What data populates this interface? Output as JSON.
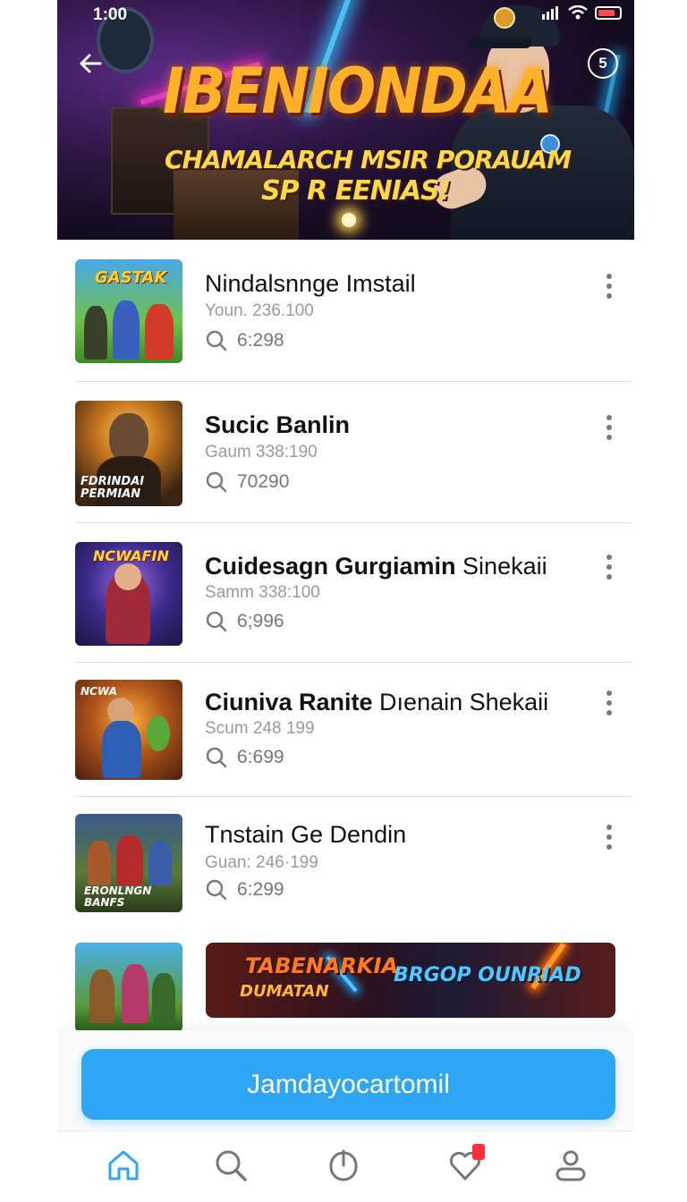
{
  "status_bar": {
    "time": "1:00"
  },
  "hero": {
    "title": "IBENIONDAA",
    "subtitle_line1": "CHAMALARCH MSIR PORAUAM",
    "subtitle_line2": "SP R EENIAS!",
    "timer_label": "5"
  },
  "games": [
    {
      "title_bold": "",
      "title_regular": "Nindalsnnge Imstail",
      "meta": "Youn. 236.100",
      "count": "6:298",
      "thumb_label": "GASTAK"
    },
    {
      "title_bold": "Sucic Banlin",
      "title_regular": "",
      "meta": "Gaum 338:190",
      "count": "70290",
      "thumb_label": "FDRINDAI PERMIAN"
    },
    {
      "title_bold": "Cuidesagn Gurgiamin",
      "title_regular": " Sinekaii",
      "meta": "Samm 338:100",
      "count": "6;996",
      "thumb_label": "NCWAFIN"
    },
    {
      "title_bold": "Ciuniva Ranite",
      "title_regular": " Dıenain Shekaii",
      "meta": "Scum 248 199",
      "count": "6:699",
      "thumb_label": "NCWA"
    },
    {
      "title_bold": "",
      "title_regular": "Tnstain Ge Dendin",
      "meta": "Guan: 246·199",
      "count": "6:299",
      "thumb_label": "ERONLNGN BANFS"
    }
  ],
  "promo": {
    "line1": "TABENARKIA",
    "line2": "DUMATAN",
    "line3": "BRGOP OUNRIAD"
  },
  "cta": {
    "label": "Jamdayocartomil"
  },
  "tabbar": {
    "items": [
      "home-icon",
      "search-icon",
      "power-icon",
      "heart-icon",
      "profile-icon"
    ],
    "active": "home-icon",
    "accent": "#2ea6f3"
  },
  "colors": {
    "accent": "#2ea6f3",
    "badge": "#ff2d3d"
  }
}
